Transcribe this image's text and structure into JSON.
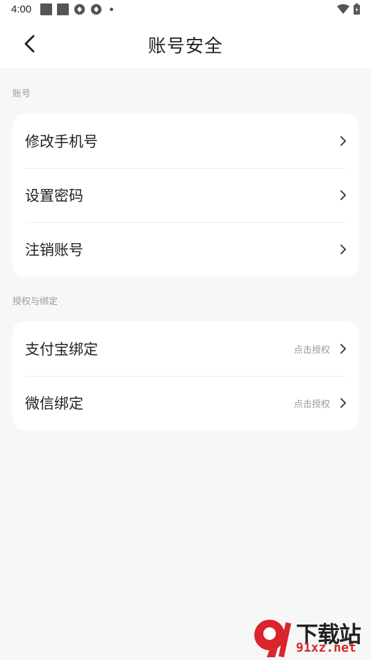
{
  "status_bar": {
    "time": "4:00",
    "icons_left": [
      "square-icon",
      "square-icon",
      "sync-icon",
      "sync-icon",
      "dot-icon"
    ],
    "icons_right": [
      "wifi-icon",
      "battery-icon"
    ]
  },
  "header": {
    "back_icon": "back-arrow-icon",
    "title": "账号安全"
  },
  "sections": [
    {
      "label": "账号",
      "items": [
        {
          "label": "修改手机号",
          "hint": ""
        },
        {
          "label": "设置密码",
          "hint": ""
        },
        {
          "label": "注销账号",
          "hint": ""
        }
      ]
    },
    {
      "label": "授权与绑定",
      "items": [
        {
          "label": "支付宝绑定",
          "hint": "点击授权"
        },
        {
          "label": "微信绑定",
          "hint": "点击授权"
        }
      ]
    }
  ],
  "watermark": {
    "text_top": "下载站",
    "text_bottom": "91xz.net",
    "logo_glyph": "9",
    "accent_color": "#d9252b"
  },
  "colors": {
    "background": "#f7f7f7",
    "card": "#ffffff",
    "primary_text": "#222222",
    "secondary_text": "#9a9a9a"
  }
}
